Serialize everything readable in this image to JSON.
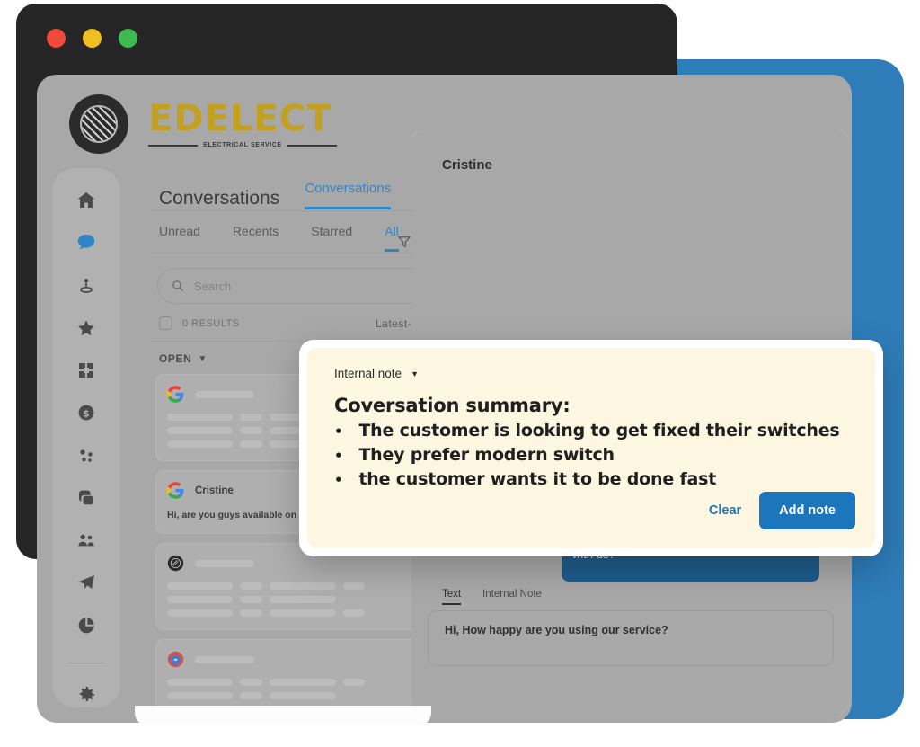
{
  "window": {
    "traffic_lights": [
      {
        "name": "close",
        "color": "#EE4B3D"
      },
      {
        "name": "minimize",
        "color": "#F0C020"
      },
      {
        "name": "zoom",
        "color": "#3FB950"
      }
    ]
  },
  "brand": {
    "name": "EDELECT",
    "tagline": "ELECTRICAL SERVICE",
    "color": "#C4A020",
    "logo_icon": "hatched-circle-logo"
  },
  "sidebar": {
    "items": [
      {
        "name": "home",
        "icon": "home-icon",
        "active": false
      },
      {
        "name": "conversations",
        "icon": "chat-bubble-icon",
        "active": true
      },
      {
        "name": "locations",
        "icon": "map-pin-icon",
        "active": false
      },
      {
        "name": "starred",
        "icon": "star-icon",
        "active": false
      },
      {
        "name": "dashboard",
        "icon": "grid-icon",
        "active": false
      },
      {
        "name": "billing",
        "icon": "dollar-coin-icon",
        "active": false
      },
      {
        "name": "automations",
        "icon": "nodes-icon",
        "active": false
      },
      {
        "name": "library",
        "icon": "layers-icon",
        "active": false
      },
      {
        "name": "contacts",
        "icon": "people-icon",
        "active": false
      },
      {
        "name": "campaigns",
        "icon": "paper-plane-icon",
        "active": false
      },
      {
        "name": "reports",
        "icon": "pie-chart-icon",
        "active": false
      }
    ],
    "footer": [
      {
        "name": "settings",
        "icon": "gear-icon",
        "active": false
      }
    ],
    "active_color": "#2E86C8"
  },
  "list_panel": {
    "title": "Conversations",
    "active_tab": "Conversations",
    "subtabs": [
      {
        "label": "Unread",
        "active": false
      },
      {
        "label": "Recents",
        "active": false
      },
      {
        "label": "Starred",
        "active": false
      },
      {
        "label": "All",
        "active": true
      }
    ],
    "search_placeholder": "Search",
    "search_value": "",
    "search_icon": "magnifier-icon",
    "filter_icon": "funnel-icon",
    "compose_icon": "compose-pencil-icon",
    "results_count_label": "0 RESULTS",
    "sort_label": "Latest-All",
    "section_label": "OPEN",
    "section_caret": "▼",
    "cards": [
      {
        "avatar": "google-logo",
        "name": "",
        "message": "",
        "skeleton": true
      },
      {
        "avatar": "google-logo",
        "name": "Cristine",
        "message": "Hi, are you guys available on tu",
        "skeleton": false
      },
      {
        "avatar": "dark-circle-logo",
        "name": "",
        "message": "",
        "skeleton": true
      },
      {
        "avatar": "messenger-logo",
        "name": "",
        "message": "",
        "skeleton": true
      }
    ]
  },
  "detail_panel": {
    "contact_name": "Cristine",
    "outgoing_bubble_text": "with us?",
    "compose_tabs": [
      {
        "label": "Text",
        "active": true
      },
      {
        "label": "Internal Note",
        "active": false
      }
    ],
    "compose_value": "Hi, How happy are you using our service?"
  },
  "note_modal": {
    "note_type": "Internal note",
    "caret": "▼",
    "title": "Coversation summary:",
    "bullets": [
      "The customer is looking to get fixed their switches",
      "They prefer modern switch",
      "the customer wants it to be done fast"
    ],
    "clear_label": "Clear",
    "add_label": "Add note",
    "background": "#FDF6E0",
    "accent": "#1B76BC"
  },
  "theme": {
    "frame_blue": "#2E7CB8",
    "dark_window": "#262626",
    "dim_grey": "#a8a8a8"
  }
}
